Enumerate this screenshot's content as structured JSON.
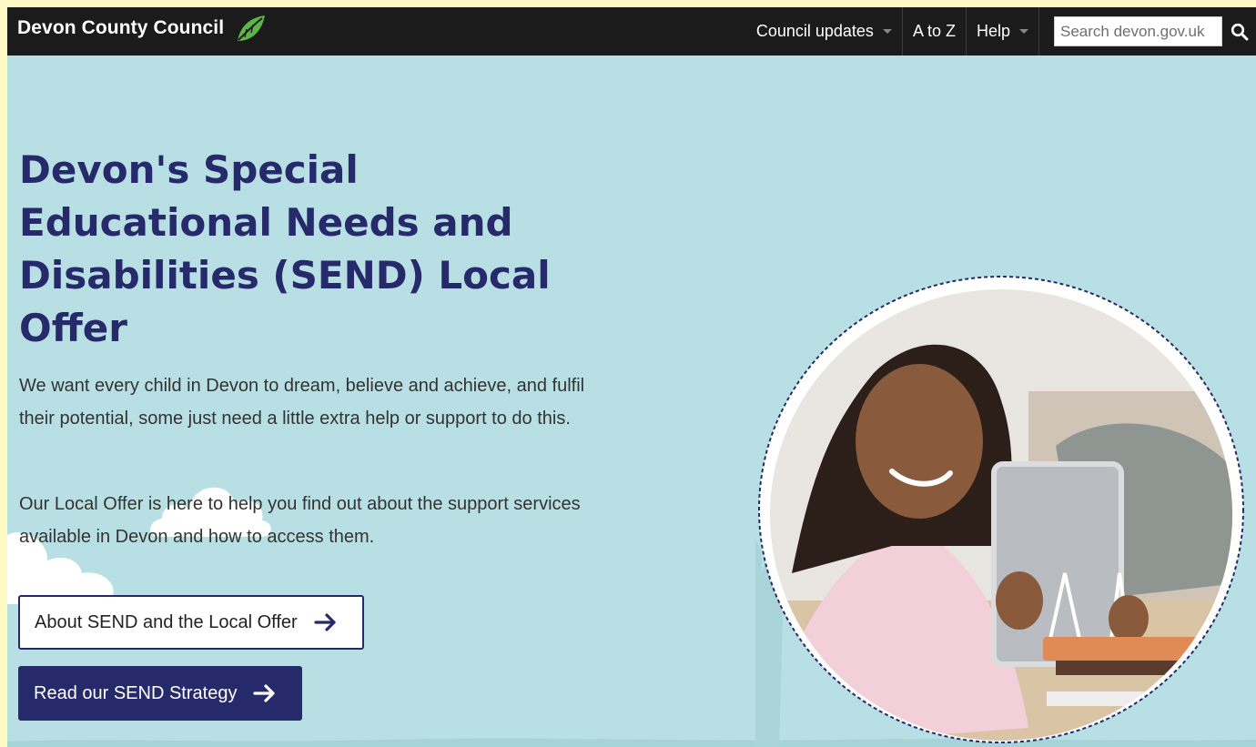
{
  "header": {
    "brand": "Devon County Council",
    "nav": {
      "council_updates": "Council updates",
      "a_to_z": "A to Z",
      "help": "Help"
    },
    "search": {
      "placeholder": "Search devon.gov.uk"
    }
  },
  "hero": {
    "title": "Devon's Special Educational Needs and Disabilities (SEND) Local Offer",
    "paragraph_1": "We want every child in Devon to dream, believe and achieve, and fulfil their potential, some just need a little extra help or support to do this.",
    "paragraph_2": "Our Local Offer is here to help you find out about the support services available in Devon and how to access them.",
    "button_about": "About SEND and the Local Offer",
    "button_strategy": "Read our SEND Strategy"
  },
  "colors": {
    "header_bg": "#1b1b1b",
    "hero_bg": "#b8dfe3",
    "title": "#262a6b",
    "button_primary": "#262a6b",
    "leaf": "#5fb548",
    "page_border": "#fff9c4"
  },
  "icons": {
    "brand_leaf": "leaf-icon",
    "search": "search-icon",
    "dropdown": "chevron-down-icon",
    "button_arrow": "arrow-right-icon"
  }
}
